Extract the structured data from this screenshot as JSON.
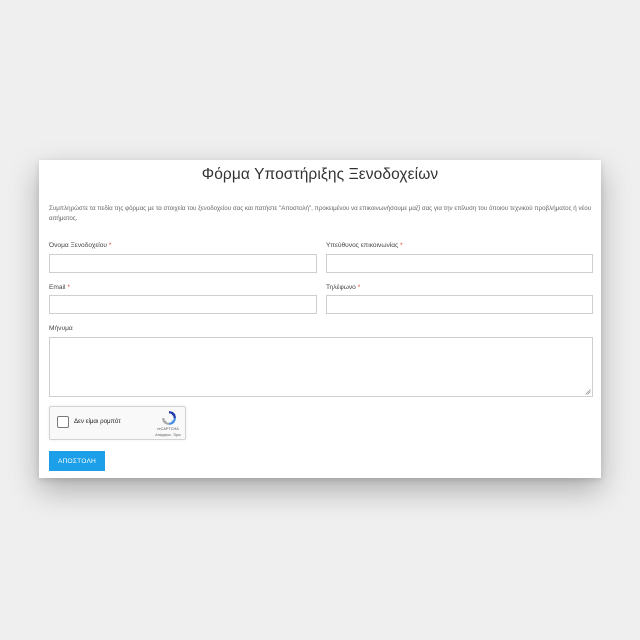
{
  "form": {
    "title": "Φόρμα Υποστήριξης Ξενοδοχείων",
    "intro": "Συμπληρώστε τα πεδία της φόρμας με τα στοιχεία του ξενοδοχείου σας και πατήστε \"Αποστολή\", προκειμένου να επικοινωνήσουμε μαζί σας για την επίλυση του όποιου τεχνικού προβλήματος ή νέου αιτήματος.",
    "required_marker": "*",
    "fields": {
      "hotel_name": {
        "label": "Όνομα Ξενοδοχείου",
        "value": ""
      },
      "contact_person": {
        "label": "Υπεύθυνος επικοινωνίας",
        "value": ""
      },
      "email": {
        "label": "Email",
        "value": ""
      },
      "phone": {
        "label": "Τηλέφωνο",
        "value": ""
      },
      "message": {
        "label": "Μήνυμα",
        "value": ""
      }
    },
    "recaptcha": {
      "label": "Δεν είμαι ρομπότ",
      "brand": "reCAPTCHA",
      "terms": "Απόρρητο - Όροι",
      "icon": "recaptcha-logo-icon"
    },
    "submit_label": "ΑΠΟΣΤΟΛΗ",
    "colors": {
      "accent": "#1a9fe8",
      "required": "#e2401c"
    }
  }
}
